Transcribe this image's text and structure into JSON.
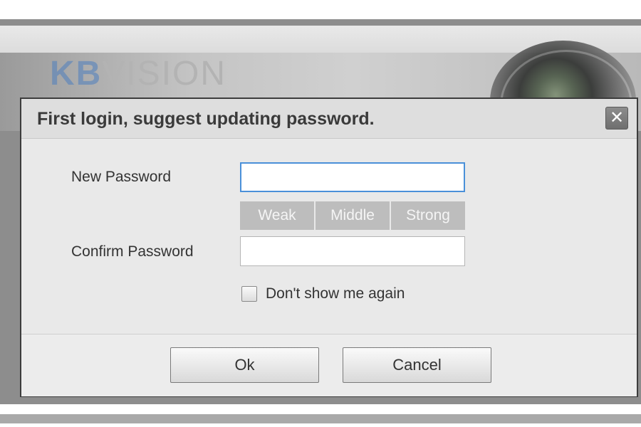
{
  "background": {
    "logo_prefix": "KB",
    "logo_suffix": "VISION"
  },
  "dialog": {
    "title": "First login, suggest updating password.",
    "close_symbol": "✕",
    "new_password_label": "New Password",
    "new_password_value": "",
    "confirm_password_label": "Confirm Password",
    "confirm_password_value": "",
    "strength_levels": [
      "Weak",
      "Middle",
      "Strong"
    ],
    "dont_show_label": "Don't show me again",
    "dont_show_checked": false,
    "ok_label": "Ok",
    "cancel_label": "Cancel"
  },
  "colors": {
    "focus_border": "#4a90d9",
    "strength_bar": "#bdbdbd",
    "title_text": "#3a3a3a"
  }
}
